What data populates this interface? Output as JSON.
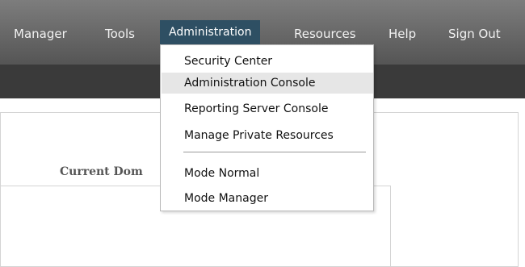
{
  "nav": {
    "items": [
      "Manager",
      "Tools",
      "Administration",
      "Resources",
      "Help",
      "Sign Out"
    ]
  },
  "dropdown": {
    "items": [
      "Security Center",
      "Administration Console",
      "Reporting Server Console",
      "Manage Private Resources",
      "Mode Normal",
      "Mode Manager"
    ]
  },
  "content": {
    "label": "Current Dom"
  },
  "colors": {
    "nav_bg": "#555555",
    "active_bg": "#2e4f63",
    "subbar_bg": "#3a3a3a",
    "hover_bg": "#e6e6e6"
  }
}
